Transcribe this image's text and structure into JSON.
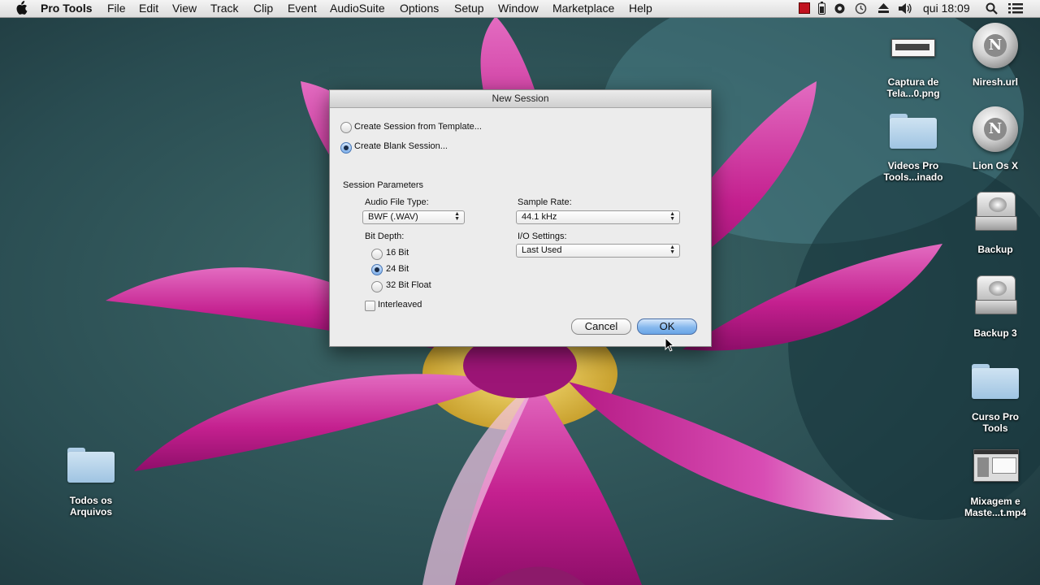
{
  "menubar": {
    "app_name": "Pro Tools",
    "items": [
      "File",
      "Edit",
      "View",
      "Track",
      "Clip",
      "Event",
      "AudioSuite",
      "Options",
      "Setup",
      "Window",
      "Marketplace",
      "Help"
    ],
    "clock": "qui 18:09",
    "status_icons": [
      "pro-tools-status-icon",
      "battery-icon",
      "gear-icon",
      "time-machine-icon",
      "eject-icon",
      "volume-icon",
      "spotlight-search-icon",
      "notification-list-icon"
    ]
  },
  "desktop_icons": [
    {
      "label_lines": [
        "Captura de",
        "Tela...0.png"
      ]
    },
    {
      "label_lines": [
        "Niresh.url"
      ]
    },
    {
      "label_lines": [
        "Videos Pro",
        "Tools...inado"
      ]
    },
    {
      "label_lines": [
        "Lion Os X"
      ]
    },
    {
      "label_lines": [
        "Backup"
      ]
    },
    {
      "label_lines": [
        "Backup 3"
      ]
    },
    {
      "label_lines": [
        "Curso Pro",
        "Tools"
      ]
    },
    {
      "label_lines": [
        "Mixagem e",
        "Maste...t.mp4"
      ]
    },
    {
      "label_lines": [
        "Todos os",
        "Arquivos"
      ]
    }
  ],
  "disc_logo": "N",
  "dialog": {
    "title": "New Session",
    "option_template": "Create Session from Template...",
    "option_blank": "Create Blank Session...",
    "selected_option": "blank",
    "section_title": "Session Parameters",
    "audio_file_type_label": "Audio File Type:",
    "audio_file_type_value": "BWF (.WAV)",
    "sample_rate_label": "Sample Rate:",
    "sample_rate_value": "44.1 kHz",
    "bit_depth_label": "Bit Depth:",
    "bit_depth_options": [
      "16 Bit",
      "24 Bit",
      "32 Bit Float"
    ],
    "bit_depth_selected": "24 Bit",
    "io_settings_label": "I/O Settings:",
    "io_settings_value": "Last Used",
    "interleaved_label": "Interleaved",
    "interleaved_checked": false,
    "cancel_label": "Cancel",
    "ok_label": "OK"
  },
  "colors": {
    "petal": "#c4208f",
    "background": "#2a4f57",
    "ok_button": "#86b8ee"
  }
}
